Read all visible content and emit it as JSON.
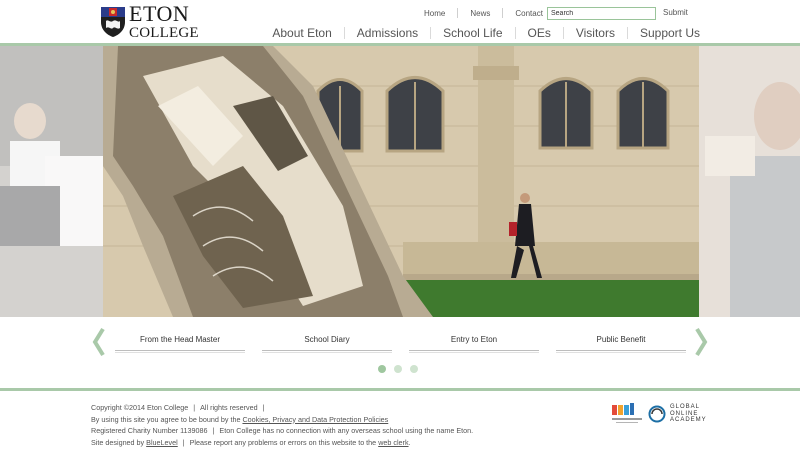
{
  "brand": {
    "line1": "ETON",
    "line2": "COLLEGE",
    "colors": {
      "accent_green": "#a9c9a9",
      "dot_active": "#9fc79f",
      "dot_inactive": "#cfe3cf"
    }
  },
  "utility_nav": {
    "items": [
      {
        "label": "Home"
      },
      {
        "label": "News"
      },
      {
        "label": "Contact"
      }
    ],
    "search": {
      "value": "",
      "placeholder": "Search"
    },
    "submit_label": "Submit"
  },
  "main_nav": {
    "items": [
      {
        "label": "About Eton"
      },
      {
        "label": "Admissions"
      },
      {
        "label": "School Life"
      },
      {
        "label": "OEs"
      },
      {
        "label": "Visitors"
      },
      {
        "label": "Support Us"
      }
    ]
  },
  "hero": {
    "slide_count": 3,
    "active_slide": 1
  },
  "quick_links": {
    "items": [
      {
        "label": "From the Head Master"
      },
      {
        "label": "School Diary"
      },
      {
        "label": "Entry to Eton"
      },
      {
        "label": "Public Benefit"
      }
    ],
    "prev_icon": "chevron-left-icon",
    "next_icon": "chevron-right-icon"
  },
  "footer": {
    "copyright": "Copyright ©2014 Eton College",
    "rights": "All rights reserved",
    "terms_prefix": "By using this site you agree to be bound by the",
    "terms_link": "Cookies, Privacy and Data Protection Policies",
    "charity": "Registered Charity Number 1139086",
    "disclaimer": "Eton College has no connection with any overseas school using the name Eton.",
    "designed_prefix": "Site designed by",
    "designed_link": "BlueLevel",
    "report_prefix": "Please report any problems or errors on this website to the",
    "report_link": "web clerk",
    "report_suffix": ".",
    "partner_goa": {
      "line1": "GLOBAL",
      "line2": "ONLINE",
      "line3": "ACADEMY"
    }
  }
}
